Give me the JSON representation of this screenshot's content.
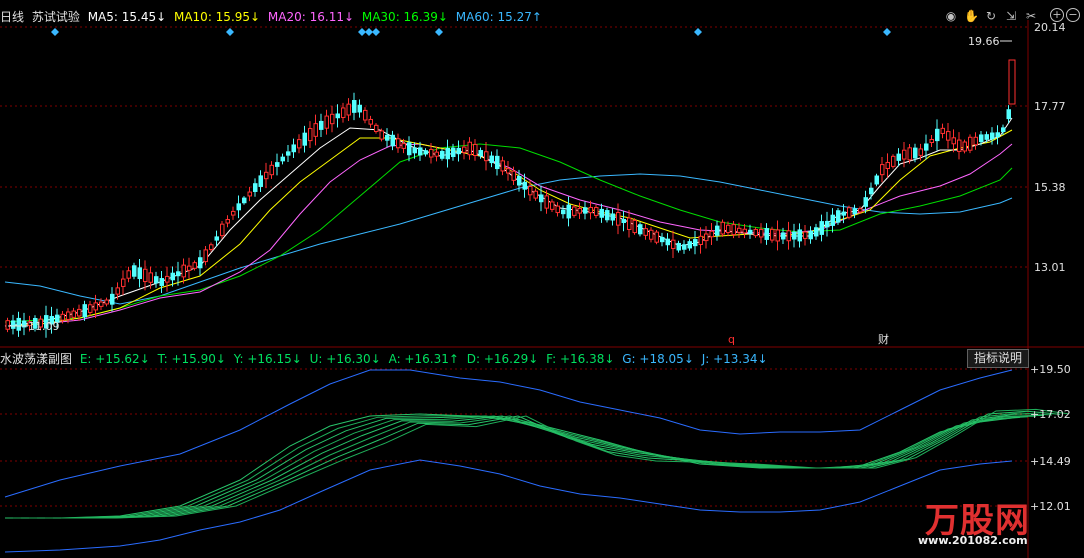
{
  "header": {
    "period": "日线",
    "stock_name": "苏试试验",
    "ma": [
      {
        "label": "MA5: 15.45↓",
        "color": "#ffffff"
      },
      {
        "label": "MA10: 15.95↓",
        "color": "#ffff00"
      },
      {
        "label": "MA20: 16.11↓",
        "color": "#ff66ff"
      },
      {
        "label": "MA30: 16.39↓",
        "color": "#00ff00"
      },
      {
        "label": "MA60: 15.27↑",
        "color": "#3ab8ff"
      }
    ]
  },
  "toolbar": {
    "icons": [
      "eye-icon",
      "hand-icon",
      "refresh-icon",
      "arrow-icon",
      "scissors-icon",
      "zoom-in-icon",
      "zoom-out-icon"
    ],
    "glyphs": [
      "◉",
      "✋",
      "↻",
      "⇲",
      "✂"
    ]
  },
  "main_axis": {
    "ticks": [
      "20.14",
      "17.77",
      "15.38",
      "13.01"
    ],
    "high_marker": "19.66",
    "low_marker": "11.09",
    "marker_q": "q",
    "marker_cai": "财"
  },
  "sub_indicator": {
    "name": "水波荡漾副图",
    "values": [
      {
        "label": "E: +15.62↓",
        "color": "#00e060"
      },
      {
        "label": "T: +15.90↓",
        "color": "#00e060"
      },
      {
        "label": "Y: +16.15↓",
        "color": "#00e060"
      },
      {
        "label": "U: +16.30↓",
        "color": "#00e060"
      },
      {
        "label": "A: +16.31↑",
        "color": "#00e060"
      },
      {
        "label": "D: +16.29↓",
        "color": "#00e060"
      },
      {
        "label": "F: +16.38↓",
        "color": "#00e060"
      },
      {
        "label": "G: +18.05↓",
        "color": "#3ab8ff"
      },
      {
        "label": "J: +13.34↓",
        "color": "#3ab8ff"
      }
    ],
    "help_button": "指标说明",
    "ticks": [
      "+19.50",
      "+17.02",
      "+14.49",
      "+12.01"
    ]
  },
  "logo": {
    "text": "万股网",
    "url": "www.201082.com"
  },
  "colors": {
    "up": "#ff3030",
    "down": "#54ffff",
    "grid": "#800000"
  }
}
